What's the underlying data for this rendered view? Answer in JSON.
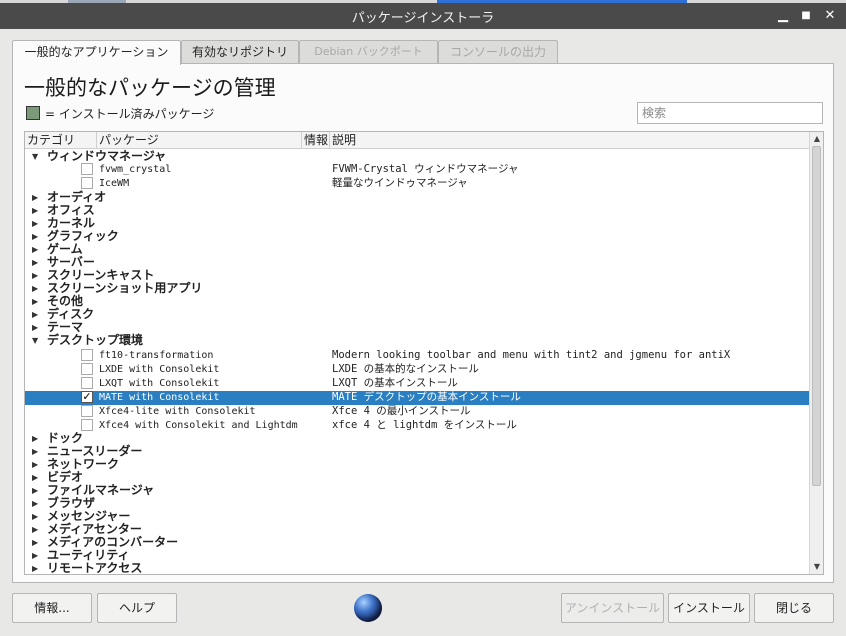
{
  "window": {
    "title": "パッケージインストーラ",
    "buttons": {
      "minimize": "▁",
      "maximize": "■",
      "close": "✕"
    }
  },
  "tabs": [
    {
      "label": "一般的なアプリケーション",
      "state": "active"
    },
    {
      "label": "有効なリポジトリ",
      "state": "normal"
    },
    {
      "label": "Debian バックポート",
      "state": "disabled"
    },
    {
      "label": "コンソールの出力",
      "state": "disabled"
    }
  ],
  "panel": {
    "heading": "一般的なパッケージの管理",
    "legend_text": "= インストール済みパッケージ",
    "legend_color": "#7a9a78",
    "search_placeholder": "検索"
  },
  "tree": {
    "columns": [
      "カテゴリ",
      "パッケージ",
      "情報",
      "説明"
    ],
    "rows": [
      {
        "kind": "category",
        "name": "ウィンドウマネージャ",
        "expanded": true
      },
      {
        "kind": "package",
        "name": "fvwm_crystal",
        "desc": "FVWM-Crystal ウィンドウマネージャ",
        "checked": false
      },
      {
        "kind": "package",
        "name": "IceWM",
        "desc": "軽量なウインドゥマネージャ",
        "checked": false
      },
      {
        "kind": "category",
        "name": "オーディオ",
        "expanded": false
      },
      {
        "kind": "category",
        "name": "オフィス",
        "expanded": false
      },
      {
        "kind": "category",
        "name": "カーネル",
        "expanded": false
      },
      {
        "kind": "category",
        "name": "グラフィック",
        "expanded": false
      },
      {
        "kind": "category",
        "name": "ゲーム",
        "expanded": false
      },
      {
        "kind": "category",
        "name": "サーバー",
        "expanded": false
      },
      {
        "kind": "category",
        "name": "スクリーンキャスト",
        "expanded": false
      },
      {
        "kind": "category",
        "name": "スクリーンショット用アプリ",
        "expanded": false
      },
      {
        "kind": "category",
        "name": "その他",
        "expanded": false
      },
      {
        "kind": "category",
        "name": "ディスク",
        "expanded": false
      },
      {
        "kind": "category",
        "name": "テーマ",
        "expanded": false
      },
      {
        "kind": "category",
        "name": "デスクトップ環境",
        "expanded": true
      },
      {
        "kind": "package",
        "name": "ft10-transformation",
        "desc": "Modern looking toolbar and menu with tint2 and jgmenu for antiX",
        "checked": false
      },
      {
        "kind": "package",
        "name": "LXDE with Consolekit",
        "desc": "LXDE の基本的なインストール",
        "checked": false
      },
      {
        "kind": "package",
        "name": "LXQT with Consolekit",
        "desc": "LXQT の基本インストール",
        "checked": false
      },
      {
        "kind": "package",
        "name": "MATE with Consolekit",
        "desc": "MATE デスクトップの基本インストール",
        "checked": true,
        "selected": true
      },
      {
        "kind": "package",
        "name": "Xfce4-lite with Consolekit",
        "desc": "Xfce 4 の最小インストール",
        "checked": false
      },
      {
        "kind": "package",
        "name": "Xfce4 with Consolekit and Lightdm",
        "desc": "xfce 4 と lightdm をインストール",
        "checked": false
      },
      {
        "kind": "category",
        "name": "ドック",
        "expanded": false
      },
      {
        "kind": "category",
        "name": "ニュースリーダー",
        "expanded": false
      },
      {
        "kind": "category",
        "name": "ネットワーク",
        "expanded": false
      },
      {
        "kind": "category",
        "name": "ビデオ",
        "expanded": false
      },
      {
        "kind": "category",
        "name": "ファイルマネージャ",
        "expanded": false
      },
      {
        "kind": "category",
        "name": "ブラウザ",
        "expanded": false
      },
      {
        "kind": "category",
        "name": "メッセンジャー",
        "expanded": false
      },
      {
        "kind": "category",
        "name": "メディアセンター",
        "expanded": false
      },
      {
        "kind": "category",
        "name": "メディアのコンバーター",
        "expanded": false
      },
      {
        "kind": "category",
        "name": "ユーティリティ",
        "expanded": false
      },
      {
        "kind": "category",
        "name": "リモートアクセス",
        "expanded": false
      }
    ],
    "icons": {
      "expanded": "▼",
      "collapsed": "▶",
      "check": "✓",
      "scroll_up": "▲",
      "scroll_down": "▼"
    },
    "selection_color": "#2a7fc2"
  },
  "footer": {
    "info_button": "情報...",
    "help_button": "ヘルプ",
    "uninstall_button": "アンインストール",
    "install_button": "インストール",
    "close_button": "閉じる",
    "logo_icon": "globe-icon"
  }
}
